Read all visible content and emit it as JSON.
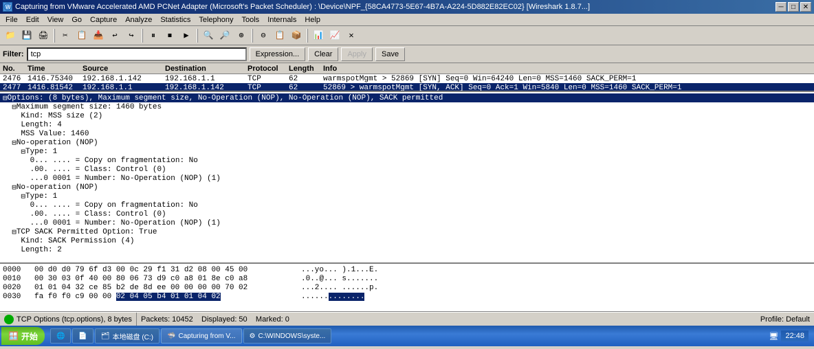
{
  "titlebar": {
    "title": "Capturing from VMware Accelerated AMD PCNet Adapter (Microsoft's Packet Scheduler) : \\Device\\NPF_{58CA4773-5E67-4B7A-A224-5D882E82EC02}   [Wireshark 1.8.7...]",
    "minimize": "─",
    "maximize": "□",
    "close": "✕"
  },
  "menubar": {
    "items": [
      "File",
      "Edit",
      "View",
      "Go",
      "Capture",
      "Analyze",
      "Statistics",
      "Telephony",
      "Tools",
      "Internals",
      "Help"
    ]
  },
  "filter": {
    "label": "Filter:",
    "value": "tcp",
    "expression_btn": "Expression...",
    "clear_btn": "Clear",
    "apply_btn": "Apply",
    "save_btn": "Save"
  },
  "packet_list": {
    "columns": [
      "No.",
      "Time",
      "Source",
      "Destination",
      "Protocol",
      "Length",
      "Info"
    ],
    "rows": [
      {
        "no": "2476",
        "time": "1416.75340",
        "src": "192.168.1.142",
        "dst": "192.168.1.1",
        "proto": "TCP",
        "len": "62",
        "info": "warmspotMgmt > 52869 [SYN] Seq=0 Win=64240 Len=0 MSS=1460 SACK_PERM=1",
        "selected": false
      },
      {
        "no": "2477",
        "time": "1416.81542",
        "src": "192.168.1.1",
        "dst": "192.168.1.142",
        "proto": "TCP",
        "len": "62",
        "info": "52869 > warmspotMgmt [SYN, ACK] Seq=0 Ack=1 Win=5840 Len=0 MSS=1460 SACK_PERM=1",
        "selected": true
      }
    ]
  },
  "packet_detail": {
    "lines": [
      {
        "indent": 0,
        "expand": "▣",
        "text": "Options: (8 bytes), Maximum segment size, No-Operation (NOP), No-Operation (NOP), SACK permitted",
        "selected": true
      },
      {
        "indent": 1,
        "expand": "▣",
        "text": "Maximum segment size: 1460 bytes",
        "selected": false
      },
      {
        "indent": 2,
        "expand": "",
        "text": "Kind: MSS size (2)",
        "selected": false
      },
      {
        "indent": 2,
        "expand": "",
        "text": "Length: 4",
        "selected": false
      },
      {
        "indent": 2,
        "expand": "",
        "text": "MSS Value: 1460",
        "selected": false
      },
      {
        "indent": 1,
        "expand": "▣",
        "text": "No-operation (NOP)",
        "selected": false
      },
      {
        "indent": 2,
        "expand": "▣",
        "text": "Type: 1",
        "selected": false
      },
      {
        "indent": 3,
        "expand": "",
        "text": "0... .... = Copy on fragmentation: No",
        "selected": false
      },
      {
        "indent": 3,
        "expand": "",
        "text": ".00. .... = Class: Control (0)",
        "selected": false
      },
      {
        "indent": 3,
        "expand": "",
        "text": "...0 0001 = Number: No-Operation (NOP) (1)",
        "selected": false
      },
      {
        "indent": 1,
        "expand": "▣",
        "text": "No-operation (NOP)",
        "selected": false
      },
      {
        "indent": 2,
        "expand": "▣",
        "text": "Type: 1",
        "selected": false
      },
      {
        "indent": 3,
        "expand": "",
        "text": "0... .... = Copy on fragmentation: No",
        "selected": false
      },
      {
        "indent": 3,
        "expand": "",
        "text": ".00. .... = Class: Control (0)",
        "selected": false
      },
      {
        "indent": 3,
        "expand": "",
        "text": "...0 0001 = Number: No-Operation (NOP) (1)",
        "selected": false
      },
      {
        "indent": 1,
        "expand": "▣",
        "text": "TCP SACK Permitted Option: True",
        "selected": false
      },
      {
        "indent": 2,
        "expand": "",
        "text": "Kind: SACK Permission (4)",
        "selected": false
      },
      {
        "indent": 2,
        "expand": "",
        "text": "Length: 2",
        "selected": false
      }
    ]
  },
  "hex_dump": {
    "lines": [
      {
        "offset": "0000",
        "bytes": "00 d0 d0 79 6f d3 00 0c  29 f1 31 d2 08 00 45 00",
        "ascii": "...yo... ).1...E."
      },
      {
        "offset": "0010",
        "bytes": "00 30 03 0f 40 00 80 06  73 d9 c0 a8 01 8e c0 a8",
        "ascii": ".0..@... s......."
      },
      {
        "offset": "0020",
        "bytes": "01 01 04 32 ce 85 b2 de  8d ee 00 00 00 00 70 02",
        "ascii": "...2.... ......p."
      },
      {
        "offset": "0030",
        "bytes": "fa f0 f0 c9 00 00",
        "ascii": "......",
        "highlight_bytes": "02 04 05 b4 01 01 04 02",
        "highlight_ascii": "........"
      }
    ]
  },
  "statusbar": {
    "indicator": "green",
    "label": "TCP Options (tcp.options), 8 bytes",
    "packets": "Packets: 10452",
    "displayed": "Displayed: 50",
    "marked": "Marked: 0",
    "profile": "Profile: Default"
  },
  "taskbar": {
    "start_label": "开始",
    "items": [
      {
        "icon": "🌐",
        "label": ""
      },
      {
        "icon": "📄",
        "label": ""
      },
      {
        "icon": "🗂",
        "label": "本地磁盘 (C:)"
      },
      {
        "icon": "🦈",
        "label": "Capturing from V..."
      },
      {
        "icon": "⚙",
        "label": "C:\\WINDOWS\\syste..."
      }
    ],
    "time": "22:48",
    "network_icon": "🖥"
  }
}
